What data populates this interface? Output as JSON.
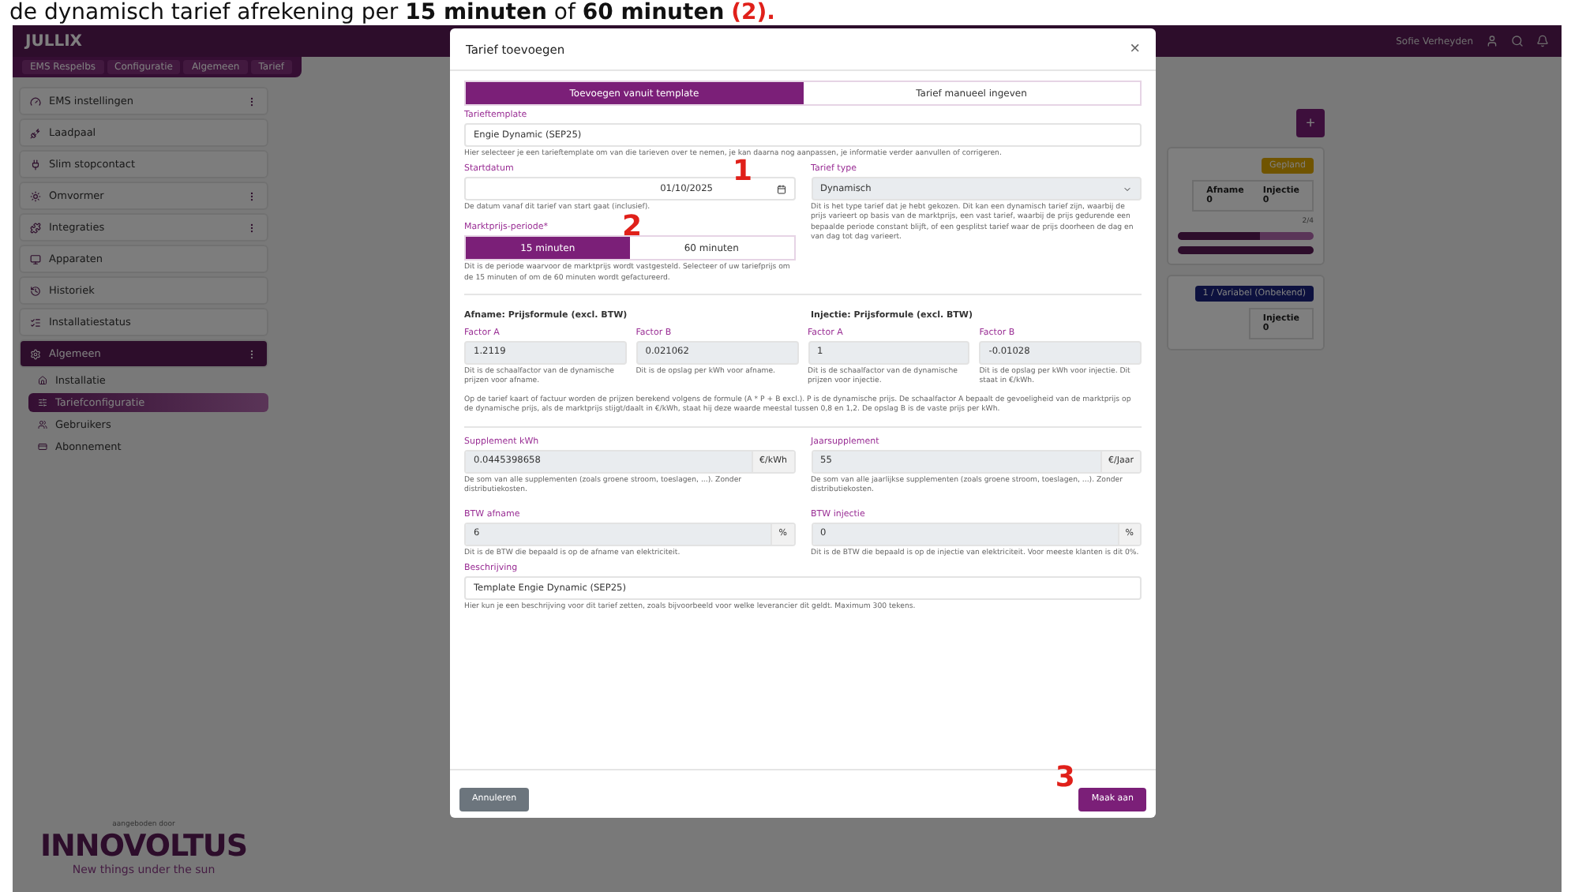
{
  "caption": {
    "text": "de dynamisch tarief afrekening per **15 minuten** of **60 minuten**",
    "marker": "(2)."
  },
  "header": {
    "logo": "JULLIX",
    "user": "Sofie Verheyden"
  },
  "breadcrumb": [
    "EMS Respelbs",
    "Configuratie",
    "Algemeen",
    "Tarief"
  ],
  "sidebar": {
    "items": [
      {
        "label": "EMS instellingen",
        "menu": true,
        "selected": false
      },
      {
        "label": "Laadpaal",
        "menu": false,
        "selected": false
      },
      {
        "label": "Slim stopcontact",
        "menu": false,
        "selected": false
      },
      {
        "label": "Omvormer",
        "menu": true,
        "selected": false
      },
      {
        "label": "Integraties",
        "menu": true,
        "selected": false
      },
      {
        "label": "Apparaten",
        "menu": false,
        "selected": false
      },
      {
        "label": "Historiek",
        "menu": false,
        "selected": false
      },
      {
        "label": "Installatiestatus",
        "menu": false,
        "selected": false
      },
      {
        "label": "Algemeen",
        "menu": true,
        "selected": true,
        "children": [
          {
            "label": "Installatie",
            "selected": false
          },
          {
            "label": "Tariefconfiguratie",
            "selected": true
          },
          {
            "label": "Gebruikers",
            "selected": false
          },
          {
            "label": "Abonnement",
            "selected": false
          }
        ]
      }
    ],
    "footer": {
      "tagline": "aangeboden door",
      "brand": "INNOVOLTUS",
      "slogan": "New things under the sun"
    }
  },
  "background": {
    "add": "+",
    "cards": [
      {
        "badge": "Gepland",
        "kind": "planned",
        "cols": [
          {
            "label": "Afname",
            "value": "0"
          },
          {
            "label": "Injectie",
            "value": "0"
          }
        ],
        "bar_label": "2/4",
        "bars": [
          {
            "level": 0.6
          },
          {
            "level": 1
          }
        ]
      },
      {
        "badge": "1 / Variabel (Onbekend)",
        "kind": "variable",
        "cols": [
          {
            "label": "Injectie",
            "value": "0"
          }
        ]
      }
    ]
  },
  "modal": {
    "title": "Tarief toevoegen",
    "close": "×",
    "tabs": [
      {
        "label": "Toevoegen vanuit template",
        "selected": true
      },
      {
        "label": "Tarief manueel ingeven",
        "selected": false
      }
    ],
    "template": {
      "label": "Tarieftemplate",
      "value": "Engie Dynamic (SEP25)",
      "help": "Hier selecteer je een tarieftemplate om van die tarieven over te nemen, je kan daarna nog aanpassen, je informatie verder aanvullen of corrigeren."
    },
    "start_date": {
      "label": "Startdatum",
      "value": "01/10/2025",
      "help": "De datum vanaf dit tarief van start gaat (inclusief).",
      "annotation": "1"
    },
    "tariff_type": {
      "label": "Tarief type",
      "value": "Dynamisch",
      "help": "Dit is het type tarief dat je hebt gekozen. Dit kan een dynamisch tarief zijn, waarbij de prijs varieert op basis van de marktprijs, een vast tarief, waarbij de prijs gedurende een bepaalde periode constant blijft, of een gesplitst tarief waar de prijs doorheen de dag en van dag tot dag varieert."
    },
    "period": {
      "label": "Marktprijs-periode*",
      "annotation": "2",
      "options": [
        {
          "label": "15 minuten",
          "selected": true
        },
        {
          "label": "60 minuten",
          "selected": false
        }
      ],
      "help": "Dit is de periode waarvoor de marktprijs wordt vastgesteld. Selecteer of uw tariefprijs om de 15 minuten of om de 60 minuten wordt gefactureerd."
    },
    "formulas": [
      {
        "title": "Afname: Prijsformule (excl. BTW)",
        "factors": [
          {
            "label": "Factor A",
            "value": "1.2119",
            "help": "Dit is de schaalfactor van de dynamische prijzen voor afname."
          },
          {
            "label": "Factor B",
            "value": "0.021062",
            "help": "Dit is de opslag per kWh voor afname."
          }
        ]
      },
      {
        "title": "Injectie: Prijsformule (excl. BTW)",
        "factors": [
          {
            "label": "Factor A",
            "value": "1",
            "help": "Dit is de schaalfactor van de dynamische prijzen voor injectie."
          },
          {
            "label": "Factor B",
            "value": "-0.01028",
            "help": "Dit is de opslag per kWh voor injectie. Dit staat in €/kWh."
          }
        ]
      }
    ],
    "formula_note": "Op de tarief kaart of factuur worden de prijzen berekend volgens de formule (A * P + B excl.). P is de dynamische prijs. De schaalfactor A bepaalt de gevoeligheid van de marktprijs op de dynamische prijs, als de marktprijs stijgt/daalt in €/kWh, staat hij deze waarde meestal tussen 0,8 en 1,2. De opslag B is de vaste prijs per kWh.",
    "supplements": [
      {
        "label": "Supplement kWh",
        "value": "0.0445398658",
        "unit": "€/kWh",
        "help": "De som van alle supplementen (zoals groene stroom, toeslagen, ...). Zonder distributiekosten."
      },
      {
        "label": "Jaarsupplement",
        "value": "55",
        "unit": "€/Jaar",
        "help": "De som van alle jaarlijkse supplementen (zoals groene stroom, toeslagen, ...). Zonder distributiekosten."
      }
    ],
    "vat": [
      {
        "label": "BTW afname",
        "value": "6",
        "unit": "%",
        "help": "Dit is de BTW die bepaald is op de afname van elektriciteit."
      },
      {
        "label": "BTW injectie",
        "value": "0",
        "unit": "%",
        "help": "Dit is de BTW die bepaald is op de injectie van elektriciteit. Voor meeste klanten is dit 0%."
      }
    ],
    "description": {
      "label": "Beschrijving",
      "value": "Template Engie Dynamic (SEP25)",
      "help": "Hier kun je een beschrijving voor dit tarief zetten, zoals bijvoorbeeld voor welke leverancier dit geldt. Maximum 300 tekens."
    },
    "buttons": [
      {
        "label": "Annuleren",
        "kind": "secondary"
      },
      {
        "label": "Maak aan",
        "kind": "primary",
        "annotation": "3"
      }
    ]
  }
}
